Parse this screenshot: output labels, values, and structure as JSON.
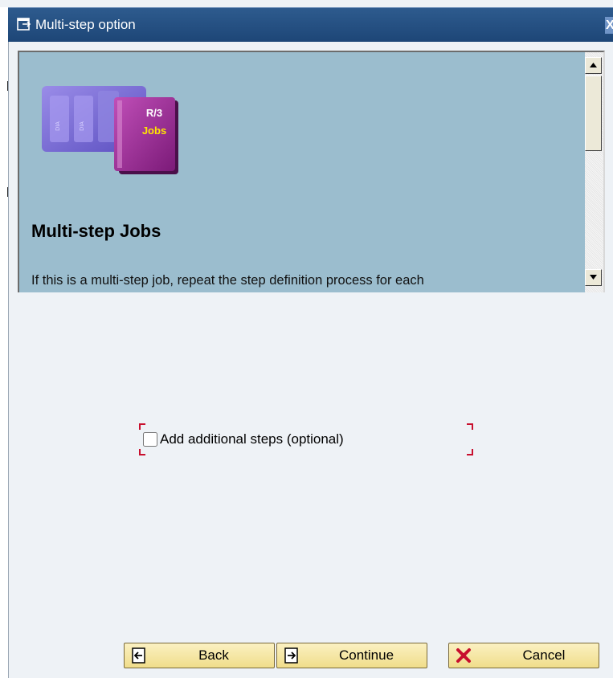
{
  "window": {
    "title": "Multi-step option",
    "close_symbol": "X"
  },
  "help": {
    "logo_text_top": "R/3",
    "logo_text_bottom": "Jobs",
    "heading": "Multi-step Jobs",
    "body": "If this is a multi-step job, repeat the step definition process for each"
  },
  "option": {
    "label": "Add additional steps (optional)",
    "checked": false
  },
  "buttons": {
    "back": "Back",
    "continue": "Continue",
    "cancel": "Cancel"
  },
  "icons": {
    "window": "dialog-window-icon",
    "back": "back-page-icon",
    "continue": "continue-page-icon",
    "cancel": "red-x-cancel-icon"
  },
  "colors": {
    "titlebar": "#1d4677",
    "help_panel": "#9bbdce",
    "button_fill": "#f5e6a3",
    "bracket": "#c8102e",
    "cancel_icon": "#c8102e"
  }
}
